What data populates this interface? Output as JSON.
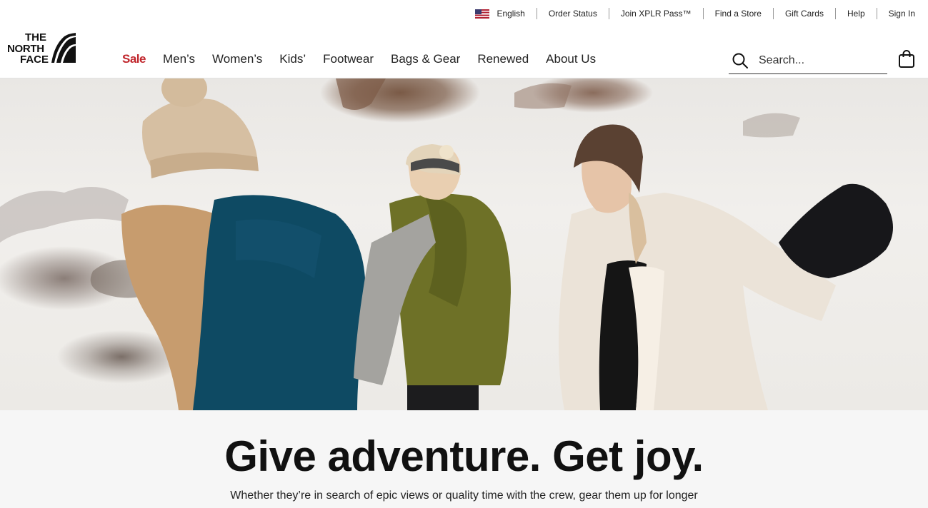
{
  "utility_nav": {
    "language": "English",
    "items": [
      "Order Status",
      "Join XPLR Pass™",
      "Find a Store",
      "Gift Cards",
      "Help",
      "Sign In"
    ]
  },
  "brand": {
    "logo_lines": [
      "THE",
      "NORTH",
      "FACE"
    ]
  },
  "main_nav": {
    "items": [
      "Sale",
      "Men’s",
      "Women’s",
      "Kids’",
      "Footwear",
      "Bags & Gear",
      "Renewed",
      "About Us"
    ]
  },
  "search": {
    "placeholder": "Search..."
  },
  "promo": {
    "headline": "Give adventure. Get joy.",
    "subtext": "Whether they’re in search of epic views or quality time with the crew, gear them up for longer"
  },
  "colors": {
    "sale": "#c0252b",
    "text": "#111111",
    "promo_background": "#f6f6f6"
  },
  "icons": [
    "us-flag-icon",
    "north-face-logo",
    "search-icon",
    "shopping-bag-icon"
  ]
}
